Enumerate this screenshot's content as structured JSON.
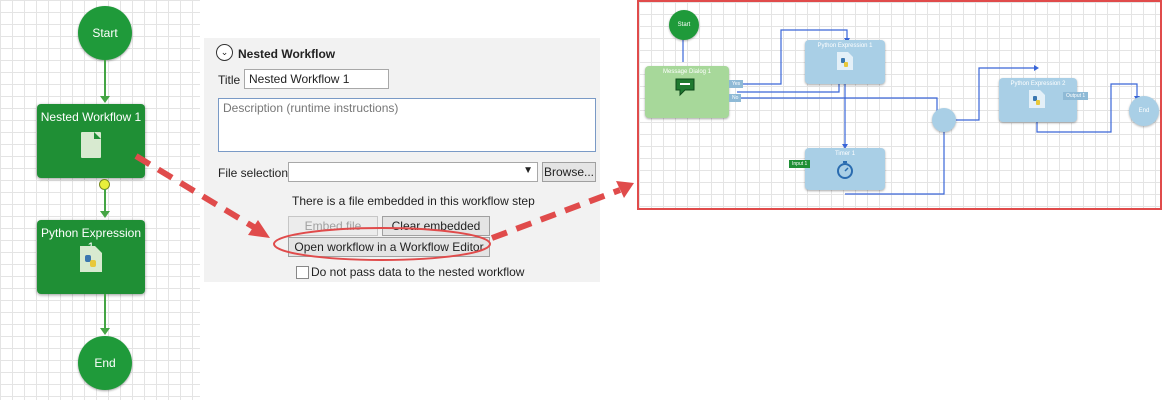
{
  "left_workflow": {
    "start_label": "Start",
    "nested_label": "Nested Workflow 1",
    "python_label": "Python Expression 1",
    "end_label": "End"
  },
  "panel": {
    "section_title": "Nested Workflow",
    "title_label": "Title",
    "title_value": "Nested Workflow 1",
    "description_placeholder": "Description (runtime instructions)",
    "file_selection_label": "File selection",
    "file_selection_value": "",
    "browse_button": "Browse...",
    "embedded_status": "There is a file embedded in this workflow step",
    "embed_file_button": "Embed file",
    "clear_embedded_button": "Clear embedded",
    "open_editor_button": "Open workflow in a Workflow Editor",
    "no_pass_data_label": "Do not pass data to the nested workflow",
    "no_pass_data_checked": false
  },
  "editor": {
    "start_label": "Start",
    "message_dialog_label": "Message Dialog 1",
    "python1_label": "Python Expression 1",
    "timer_label": "Timer 1",
    "python2_label": "Python Expression 2",
    "end_label": "End",
    "port_yes": "Yes",
    "port_no": "No",
    "port_input1": "Input 1",
    "port_output1": "Output 1"
  },
  "colors": {
    "node_green": "#1f8f35",
    "node_blue": "#a9cfe6",
    "connector_blue": "#3a66d8",
    "highlight_red": "#e04b4b"
  }
}
